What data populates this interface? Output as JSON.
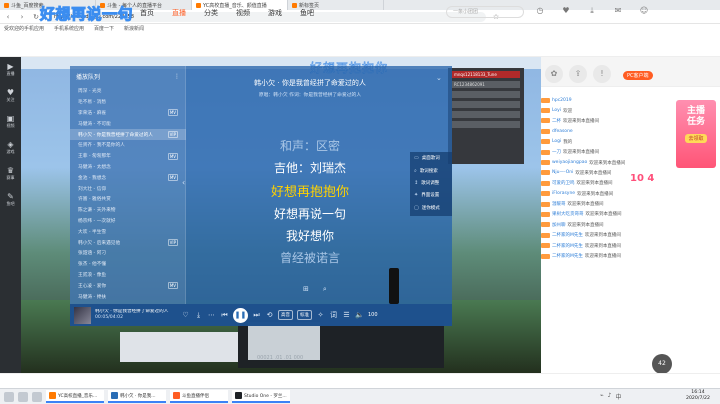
{
  "browser": {
    "tabs": [
      {
        "label": "斗鱼_百度搜索"
      },
      {
        "label": "斗鱼 - 每个人的直播平台"
      },
      {
        "label": "YC高校直播_音乐、颜值直播"
      },
      {
        "label": "新标签页"
      }
    ],
    "url": "https://www.douyu.com/228658",
    "bookmarks": [
      "受欢迎的手机应用",
      "手机系统应用",
      "百度一下",
      "新浪新闻"
    ]
  },
  "douyu": {
    "brand_text": "好想再说一句",
    "nav": [
      "首页",
      "直播",
      "分类",
      "视频",
      "游戏",
      "鱼吧"
    ],
    "active_nav": "直播",
    "search_placeholder": "一条小团团",
    "header_icons": [
      "history-icon",
      "follow-icon",
      "download-icon",
      "message-icon",
      "avatar-icon"
    ],
    "rail": [
      {
        "icon": "live-icon",
        "label": "直播"
      },
      {
        "icon": "follow-icon",
        "label": "关注"
      },
      {
        "icon": "video-icon",
        "label": "视频"
      },
      {
        "icon": "game-icon",
        "label": "游戏"
      },
      {
        "icon": "match-icon",
        "label": "赛事"
      },
      {
        "icon": "yuba-icon",
        "label": "鱼吧"
      }
    ],
    "overlay_title": "好想再抱抱你",
    "pc_client": "PC客户端",
    "promo": {
      "line1": "主播",
      "line2": "任务",
      "button": "去领取"
    },
    "vs_tag": "10 4",
    "viewer_badge": "42"
  },
  "chat": {
    "messages": [
      {
        "user": "hpc2019",
        "text": ""
      },
      {
        "user": "Loyi",
        "text": "欢迎"
      },
      {
        "user": "二杯",
        "text": "欢迎来到本直播间"
      },
      {
        "user": "dfeasone",
        "text": ""
      },
      {
        "user": "Logi",
        "text": "我的"
      },
      {
        "user": "一刀",
        "text": "欢迎来到本直播间"
      },
      {
        "user": "weiyaojiangpao",
        "text": "欢迎来到本直播间"
      },
      {
        "user": "Nju—-Oni",
        "text": "欢迎来到本直播间"
      },
      {
        "user": "可爱的卫鸣",
        "text": "欢迎来到本直播间"
      },
      {
        "user": "iFlorasyne",
        "text": "欢迎来到本直播间"
      },
      {
        "user": "温暖哥",
        "text": "欢迎来到本直播间"
      },
      {
        "user": "果树大吃货哥哥",
        "text": "欢迎来到本直播间"
      },
      {
        "user": "加州聊",
        "text": "欢迎来到本直播间"
      },
      {
        "user": "二杯家的M先生",
        "text": "欢迎来到本直播间"
      },
      {
        "user": "二杯家的M先生",
        "text": "欢迎来到本直播间"
      },
      {
        "user": "二杯家的M先生",
        "text": "欢迎来到本直播间"
      }
    ]
  },
  "player": {
    "playlist_title": "播放队列",
    "song_title": "韩小欠 · 你是我曾经拼了命爱过的人",
    "credits": "原唱：韩小欠  作词：你是我曾经拼了命爱过的人",
    "lyrics": [
      "和声：区密",
      "吉他：刘瑞杰",
      "好想再抱抱你",
      "好想再说一句",
      "我好想你",
      "曾经被诺言"
    ],
    "playlist": [
      {
        "title": "周深 - 光亮",
        "badge": ""
      },
      {
        "title": "毛不易 - 消愁",
        "badge": ""
      },
      {
        "title": "李荣浩 - 麻雀",
        "badge": "MV"
      },
      {
        "title": "马健涛 - 不可能",
        "badge": ""
      },
      {
        "title": "韩小欠 - 你是我曾经拼了命爱过的人",
        "badge": "VIP"
      },
      {
        "title": "任贤齐 - 我不是你的人",
        "badge": ""
      },
      {
        "title": "王菲 - 匆匆那年",
        "badge": "MV"
      },
      {
        "title": "马健涛 - 太想念",
        "badge": ""
      },
      {
        "title": "金池 - 我想念",
        "badge": "MV"
      },
      {
        "title": "刘大壮 - 信仰",
        "badge": ""
      },
      {
        "title": "许嵩 - 雅俗共赏",
        "badge": ""
      },
      {
        "title": "陈之谦 - 天外来物",
        "badge": ""
      },
      {
        "title": "杨宗纬 - 一次就好",
        "badge": ""
      },
      {
        "title": "大欢 - 半生雪",
        "badge": ""
      },
      {
        "title": "韩小欠 - 后来遇见他",
        "badge": "VIP"
      },
      {
        "title": "张韶涵 - 阿刁",
        "badge": ""
      },
      {
        "title": "张杰 - 他不懂",
        "badge": ""
      },
      {
        "title": "王贰浪 - 像鱼",
        "badge": ""
      },
      {
        "title": "王心凌 - 爱你",
        "badge": "MV"
      },
      {
        "title": "马健涛 - 搀扶",
        "badge": ""
      }
    ],
    "side_tools": [
      {
        "icon": "desktop-lyric-icon",
        "label": "桌面歌词"
      },
      {
        "icon": "lyric-search-icon",
        "label": "歌词搜索"
      },
      {
        "icon": "lyric-adjust-icon",
        "label": "歌词调整"
      },
      {
        "icon": "skin-icon",
        "label": "界面设置"
      },
      {
        "icon": "window-icon",
        "label": "迷你模式"
      }
    ],
    "now_playing": {
      "title": "韩小欠 · 你是我曾经拼了命爱过的人",
      "time": "00:05/04:02"
    },
    "tags": [
      "高音",
      "标准"
    ],
    "volume": "100"
  },
  "chat_window": {
    "rows": [
      "mnqs12118133_Tune",
      "RC1234862091",
      "",
      "",
      "",
      ""
    ]
  },
  "daw": {
    "time": "00021 .01 .01 000"
  },
  "taskbar": {
    "apps": [
      {
        "label": "YC高校直播_音乐...",
        "color": "#ff7a00"
      },
      {
        "label": "韩小欠 · 你是我...",
        "color": "#2a6db5"
      },
      {
        "label": "斗鱼直播伴侣",
        "color": "#ff5d23"
      },
      {
        "label": "Studio One - 罗兰...",
        "color": "#1e2226"
      }
    ],
    "time": "16:14",
    "date": "2020/7/22"
  }
}
